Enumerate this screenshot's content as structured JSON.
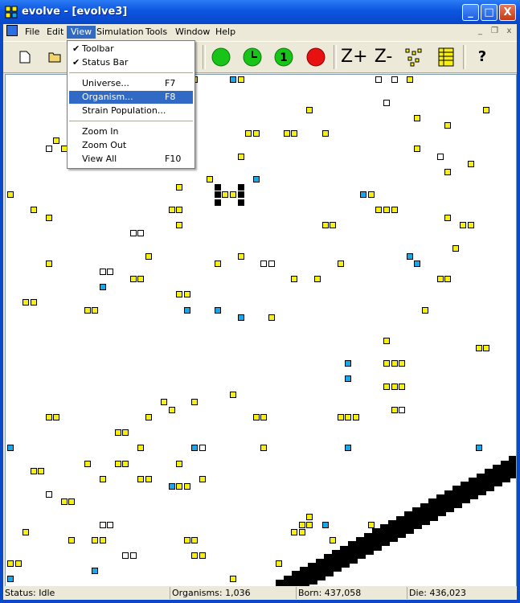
{
  "window": {
    "title": "evolve - [evolve3]",
    "minimize": "_",
    "maximize": "□",
    "close": "X"
  },
  "menubar": {
    "items": [
      "File",
      "Edit",
      "View",
      "Simulation",
      "Tools",
      "Window",
      "Help"
    ],
    "active": "View"
  },
  "mdi_controls": [
    "_",
    "❐",
    "x"
  ],
  "toolbar": {
    "buttons": [
      {
        "name": "new-icon",
        "glyph": "🗋"
      },
      {
        "name": "open-icon",
        "glyph": "📂"
      },
      {
        "name": "run-icon",
        "glyph": "●",
        "color": "#19c419"
      },
      {
        "name": "timer-icon",
        "glyph": "🕓",
        "color": "#19c419"
      },
      {
        "name": "step-one-icon",
        "glyph": "1",
        "color": "#19c419"
      },
      {
        "name": "stop-icon",
        "glyph": "●",
        "color": "#e81010"
      },
      {
        "name": "zoom-in-icon",
        "glyph": "Z+"
      },
      {
        "name": "zoom-out-icon",
        "glyph": "Z-"
      },
      {
        "name": "scatter-icon",
        "glyph": "⁘"
      },
      {
        "name": "grid-icon",
        "glyph": "▦"
      },
      {
        "name": "help-icon",
        "glyph": "?"
      }
    ]
  },
  "view_menu": {
    "items": [
      {
        "label": "Toolbar",
        "checked": "✔",
        "accel": ""
      },
      {
        "label": "Status Bar",
        "checked": "✔",
        "accel": ""
      },
      {
        "label": "Universe...",
        "checked": "",
        "accel": "F7"
      },
      {
        "label": "Organism...",
        "checked": "",
        "accel": "F8",
        "highlighted": true
      },
      {
        "label": "Strain Population...",
        "checked": "",
        "accel": ""
      },
      {
        "label": "Zoom In",
        "checked": "",
        "accel": ""
      },
      {
        "label": "Zoom Out",
        "checked": "",
        "accel": ""
      },
      {
        "label": "View All",
        "checked": "",
        "accel": "F10"
      }
    ]
  },
  "status": {
    "status": "Status: Idle",
    "organisms": "Organisms: 1,036",
    "born": "Born: 437,058",
    "die": "Die: 436,023"
  },
  "colors": {
    "yellow": "#f7ee14",
    "blue": "#18a7e8",
    "white": "#ffffff",
    "black": "#000000",
    "selection": "#316ac5"
  },
  "universe": {
    "cells": [
      {
        "t": "y",
        "c": 24,
        "r": 0
      },
      {
        "t": "b",
        "c": 29,
        "r": 0
      },
      {
        "t": "y",
        "c": 30,
        "r": 0
      },
      {
        "t": "w",
        "c": 48,
        "r": 0
      },
      {
        "t": "w",
        "c": 50,
        "r": 0
      },
      {
        "t": "y",
        "c": 52,
        "r": 0
      },
      {
        "t": "w",
        "c": 49,
        "r": 3
      },
      {
        "t": "y",
        "c": 39,
        "r": 4
      },
      {
        "t": "y",
        "c": 62,
        "r": 4
      },
      {
        "t": "y",
        "c": 53,
        "r": 5
      },
      {
        "t": "y",
        "c": 57,
        "r": 6
      },
      {
        "t": "y",
        "c": 31,
        "r": 7
      },
      {
        "t": "y",
        "c": 32,
        "r": 7
      },
      {
        "t": "y",
        "c": 36,
        "r": 7
      },
      {
        "t": "y",
        "c": 37,
        "r": 7
      },
      {
        "t": "y",
        "c": 41,
        "r": 7
      },
      {
        "t": "y",
        "c": 6,
        "r": 8
      },
      {
        "t": "w",
        "c": 5,
        "r": 9
      },
      {
        "t": "y",
        "c": 7,
        "r": 9
      },
      {
        "t": "y",
        "c": 53,
        "r": 9
      },
      {
        "t": "y",
        "c": 30,
        "r": 10
      },
      {
        "t": "w",
        "c": 56,
        "r": 10
      },
      {
        "t": "y",
        "c": 60,
        "r": 11
      },
      {
        "t": "y",
        "c": 57,
        "r": 12
      },
      {
        "t": "y",
        "c": 26,
        "r": 13
      },
      {
        "t": "b",
        "c": 32,
        "r": 13
      },
      {
        "t": "y",
        "c": 22,
        "r": 14
      },
      {
        "t": "k",
        "c": 27,
        "r": 14
      },
      {
        "t": "k",
        "c": 30,
        "r": 14
      },
      {
        "t": "y",
        "c": 0,
        "r": 15
      },
      {
        "t": "k",
        "c": 27,
        "r": 15
      },
      {
        "t": "y",
        "c": 28,
        "r": 15
      },
      {
        "t": "y",
        "c": 29,
        "r": 15
      },
      {
        "t": "k",
        "c": 30,
        "r": 15
      },
      {
        "t": "b",
        "c": 46,
        "r": 15
      },
      {
        "t": "y",
        "c": 47,
        "r": 15
      },
      {
        "t": "k",
        "c": 27,
        "r": 16
      },
      {
        "t": "k",
        "c": 30,
        "r": 16
      },
      {
        "t": "y",
        "c": 3,
        "r": 17
      },
      {
        "t": "y",
        "c": 21,
        "r": 17
      },
      {
        "t": "y",
        "c": 22,
        "r": 17
      },
      {
        "t": "y",
        "c": 48,
        "r": 17
      },
      {
        "t": "y",
        "c": 49,
        "r": 17
      },
      {
        "t": "y",
        "c": 50,
        "r": 17
      },
      {
        "t": "y",
        "c": 5,
        "r": 18
      },
      {
        "t": "y",
        "c": 57,
        "r": 18
      },
      {
        "t": "y",
        "c": 22,
        "r": 19
      },
      {
        "t": "y",
        "c": 41,
        "r": 19
      },
      {
        "t": "y",
        "c": 42,
        "r": 19
      },
      {
        "t": "y",
        "c": 59,
        "r": 19
      },
      {
        "t": "y",
        "c": 60,
        "r": 19
      },
      {
        "t": "w",
        "c": 16,
        "r": 20
      },
      {
        "t": "w",
        "c": 17,
        "r": 20
      },
      {
        "t": "y",
        "c": 58,
        "r": 22
      },
      {
        "t": "y",
        "c": 18,
        "r": 23
      },
      {
        "t": "y",
        "c": 30,
        "r": 23
      },
      {
        "t": "b",
        "c": 52,
        "r": 23
      },
      {
        "t": "y",
        "c": 5,
        "r": 24
      },
      {
        "t": "y",
        "c": 27,
        "r": 24
      },
      {
        "t": "w",
        "c": 33,
        "r": 24
      },
      {
        "t": "w",
        "c": 34,
        "r": 24
      },
      {
        "t": "y",
        "c": 43,
        "r": 24
      },
      {
        "t": "b",
        "c": 53,
        "r": 24
      },
      {
        "t": "w",
        "c": 12,
        "r": 25
      },
      {
        "t": "w",
        "c": 13,
        "r": 25
      },
      {
        "t": "y",
        "c": 16,
        "r": 26
      },
      {
        "t": "y",
        "c": 17,
        "r": 26
      },
      {
        "t": "y",
        "c": 37,
        "r": 26
      },
      {
        "t": "y",
        "c": 40,
        "r": 26
      },
      {
        "t": "y",
        "c": 56,
        "r": 26
      },
      {
        "t": "y",
        "c": 57,
        "r": 26
      },
      {
        "t": "b",
        "c": 12,
        "r": 27
      },
      {
        "t": "y",
        "c": 22,
        "r": 28
      },
      {
        "t": "y",
        "c": 23,
        "r": 28
      },
      {
        "t": "y",
        "c": 2,
        "r": 29
      },
      {
        "t": "y",
        "c": 3,
        "r": 29
      },
      {
        "t": "y",
        "c": 10,
        "r": 30
      },
      {
        "t": "y",
        "c": 11,
        "r": 30
      },
      {
        "t": "b",
        "c": 23,
        "r": 30
      },
      {
        "t": "b",
        "c": 27,
        "r": 30
      },
      {
        "t": "y",
        "c": 54,
        "r": 30
      },
      {
        "t": "b",
        "c": 30,
        "r": 31
      },
      {
        "t": "y",
        "c": 34,
        "r": 31
      },
      {
        "t": "y",
        "c": 49,
        "r": 34
      },
      {
        "t": "y",
        "c": 61,
        "r": 35
      },
      {
        "t": "y",
        "c": 62,
        "r": 35
      },
      {
        "t": "b",
        "c": 44,
        "r": 37
      },
      {
        "t": "y",
        "c": 49,
        "r": 37
      },
      {
        "t": "y",
        "c": 50,
        "r": 37
      },
      {
        "t": "y",
        "c": 51,
        "r": 37
      },
      {
        "t": "b",
        "c": 44,
        "r": 39
      },
      {
        "t": "y",
        "c": 49,
        "r": 40
      },
      {
        "t": "y",
        "c": 50,
        "r": 40
      },
      {
        "t": "y",
        "c": 51,
        "r": 40
      },
      {
        "t": "y",
        "c": 29,
        "r": 41
      },
      {
        "t": "y",
        "c": 20,
        "r": 42
      },
      {
        "t": "y",
        "c": 24,
        "r": 42
      },
      {
        "t": "y",
        "c": 21,
        "r": 43
      },
      {
        "t": "y",
        "c": 50,
        "r": 43
      },
      {
        "t": "w",
        "c": 51,
        "r": 43
      },
      {
        "t": "y",
        "c": 5,
        "r": 44
      },
      {
        "t": "y",
        "c": 6,
        "r": 44
      },
      {
        "t": "y",
        "c": 18,
        "r": 44
      },
      {
        "t": "y",
        "c": 32,
        "r": 44
      },
      {
        "t": "y",
        "c": 33,
        "r": 44
      },
      {
        "t": "y",
        "c": 43,
        "r": 44
      },
      {
        "t": "y",
        "c": 44,
        "r": 44
      },
      {
        "t": "y",
        "c": 45,
        "r": 44
      },
      {
        "t": "y",
        "c": 14,
        "r": 46
      },
      {
        "t": "y",
        "c": 15,
        "r": 46
      },
      {
        "t": "b",
        "c": 0,
        "r": 48
      },
      {
        "t": "y",
        "c": 17,
        "r": 48
      },
      {
        "t": "b",
        "c": 24,
        "r": 48
      },
      {
        "t": "w",
        "c": 25,
        "r": 48
      },
      {
        "t": "y",
        "c": 33,
        "r": 48
      },
      {
        "t": "b",
        "c": 44,
        "r": 48
      },
      {
        "t": "b",
        "c": 61,
        "r": 48
      },
      {
        "t": "y",
        "c": 10,
        "r": 50
      },
      {
        "t": "y",
        "c": 14,
        "r": 50
      },
      {
        "t": "y",
        "c": 15,
        "r": 50
      },
      {
        "t": "y",
        "c": 22,
        "r": 50
      },
      {
        "t": "y",
        "c": 3,
        "r": 51
      },
      {
        "t": "y",
        "c": 4,
        "r": 51
      },
      {
        "t": "y",
        "c": 12,
        "r": 52
      },
      {
        "t": "y",
        "c": 17,
        "r": 52
      },
      {
        "t": "y",
        "c": 18,
        "r": 52
      },
      {
        "t": "y",
        "c": 25,
        "r": 52
      },
      {
        "t": "b",
        "c": 21,
        "r": 53
      },
      {
        "t": "y",
        "c": 22,
        "r": 53
      },
      {
        "t": "y",
        "c": 23,
        "r": 53
      },
      {
        "t": "w",
        "c": 5,
        "r": 54
      },
      {
        "t": "y",
        "c": 7,
        "r": 55
      },
      {
        "t": "y",
        "c": 8,
        "r": 55
      },
      {
        "t": "y",
        "c": 39,
        "r": 57
      },
      {
        "t": "w",
        "c": 12,
        "r": 58
      },
      {
        "t": "w",
        "c": 13,
        "r": 58
      },
      {
        "t": "y",
        "c": 38,
        "r": 58
      },
      {
        "t": "y",
        "c": 39,
        "r": 58
      },
      {
        "t": "b",
        "c": 41,
        "r": 58
      },
      {
        "t": "y",
        "c": 47,
        "r": 58
      },
      {
        "t": "y",
        "c": 2,
        "r": 59
      },
      {
        "t": "y",
        "c": 37,
        "r": 59
      },
      {
        "t": "y",
        "c": 38,
        "r": 59
      },
      {
        "t": "y",
        "c": 8,
        "r": 60
      },
      {
        "t": "y",
        "c": 11,
        "r": 60
      },
      {
        "t": "y",
        "c": 12,
        "r": 60
      },
      {
        "t": "y",
        "c": 23,
        "r": 60
      },
      {
        "t": "y",
        "c": 24,
        "r": 60
      },
      {
        "t": "y",
        "c": 42,
        "r": 60
      },
      {
        "t": "w",
        "c": 15,
        "r": 62
      },
      {
        "t": "w",
        "c": 16,
        "r": 62
      },
      {
        "t": "y",
        "c": 24,
        "r": 62
      },
      {
        "t": "y",
        "c": 25,
        "r": 62
      },
      {
        "t": "y",
        "c": 0,
        "r": 63
      },
      {
        "t": "y",
        "c": 1,
        "r": 63
      },
      {
        "t": "y",
        "c": 35,
        "r": 63
      },
      {
        "t": "b",
        "c": 11,
        "r": 64
      },
      {
        "t": "b",
        "c": 0,
        "r": 65
      },
      {
        "t": "y",
        "c": 29,
        "r": 65
      }
    ],
    "diagonal_band": true
  }
}
